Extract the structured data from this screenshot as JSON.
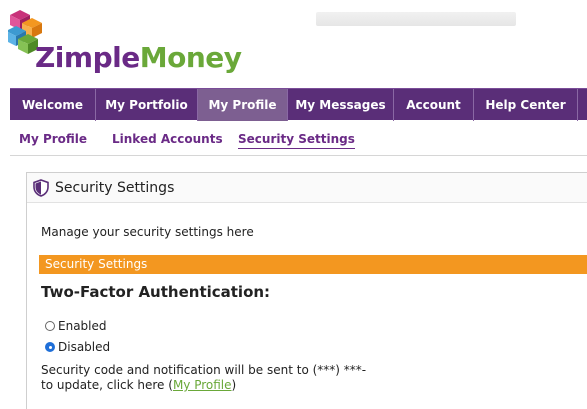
{
  "brand": {
    "logo_part1": "Zimple",
    "logo_part2": "Money",
    "colors": {
      "purple": "#5a2e78",
      "green": "#6aa839",
      "orange": "#f39720"
    }
  },
  "nav": {
    "items": [
      {
        "label": "Welcome",
        "active": false
      },
      {
        "label": "My Portfolio",
        "active": false
      },
      {
        "label": "My Profile",
        "active": true
      },
      {
        "label": "My Messages",
        "active": false
      },
      {
        "label": "Account",
        "active": false
      },
      {
        "label": "Help Center",
        "active": false
      }
    ]
  },
  "subnav": {
    "items": [
      {
        "label": "My Profile",
        "active": false
      },
      {
        "label": "Linked Accounts",
        "active": false
      },
      {
        "label": "Security Settings",
        "active": true
      }
    ]
  },
  "panel": {
    "icon": "shield-icon",
    "title": "Security Settings",
    "manage_text": "Manage your security settings here",
    "section_label": "Security Settings",
    "tfa_title": "Two-Factor Authentication:",
    "options": [
      {
        "label": "Enabled",
        "checked": false
      },
      {
        "label": "Disabled",
        "checked": true
      }
    ],
    "note_line1": "Security code and notification will be sent to (***) ***-",
    "note_line2_prefix": "to update, click here (",
    "note_link": "My Profile",
    "note_line2_suffix": ")"
  }
}
